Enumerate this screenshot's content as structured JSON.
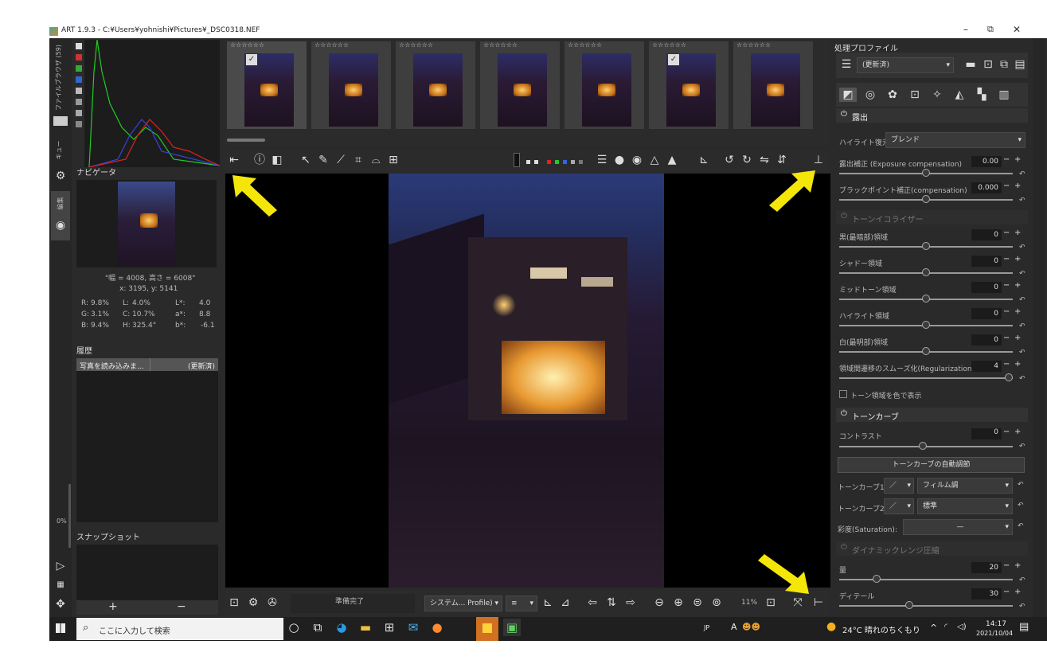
{
  "window": {
    "title": "ART 1.9.3 - C:¥Users¥yohnishi¥Pictures¥_DSC0318.NEF",
    "controls": {
      "minimize": "–",
      "restore": "⧉",
      "close": "✕"
    }
  },
  "left_tabs": {
    "file_browser": "ファイルブラウザ (59)",
    "queue": "キュー",
    "edit": "編集"
  },
  "navigator": {
    "title": "ナビゲータ",
    "size_line": "\"幅 = 4008, 高さ = 6008\"",
    "coords": "x: 3195, y: 5141",
    "rows": [
      [
        "R:",
        "9.8%",
        "L:",
        "4.0%",
        "L*:",
        "4.0"
      ],
      [
        "G:",
        "3.1%",
        "C:",
        "10.7%",
        "a*:",
        "8.8"
      ],
      [
        "B:",
        "9.4%",
        "H:",
        "325.4°",
        "b*:",
        "-6.1"
      ]
    ]
  },
  "history": {
    "title": "履歴",
    "rows": [
      {
        "action": "写真を読み込みま...",
        "value": "(更新済)"
      }
    ]
  },
  "snapshots": {
    "title": "スナップショット",
    "add": "+",
    "remove": "−"
  },
  "left_zoom_pct": "0%",
  "filmstrip": {
    "stars": "☆☆☆☆☆☆",
    "count": 7
  },
  "status": {
    "text": "準備完了",
    "profile": "システム... Profile)",
    "zoom": "11%"
  },
  "right_panel": {
    "profile_title": "処理プロファイル",
    "profile_value": "(更新済)",
    "exposure": {
      "title": "露出",
      "highlight_label": "ハイライト復元:",
      "highlight_value": "ブレンド",
      "items": [
        {
          "label": "露出補正 (Exposure compensation)",
          "value": "0.00",
          "pos": 0.5
        },
        {
          "label": "ブラックポイント補正(compensation)",
          "value": "0.000",
          "pos": 0.5
        }
      ]
    },
    "tone_eq": {
      "title": "トーンイコライザー",
      "items": [
        {
          "label": "黒(最暗部)領域",
          "value": "0",
          "pos": 0.5
        },
        {
          "label": "シャドー領域",
          "value": "0",
          "pos": 0.5
        },
        {
          "label": "ミッドトーン領域",
          "value": "0",
          "pos": 0.5
        },
        {
          "label": "ハイライト領域",
          "value": "0",
          "pos": 0.5
        },
        {
          "label": "白(最明部)領域",
          "value": "0",
          "pos": 0.5
        },
        {
          "label": "領域間遷移のスムーズ化(Regularization)",
          "value": "4",
          "pos": 1.0
        }
      ],
      "show_colors": "トーン領域を色で表示"
    },
    "tone_curve": {
      "title": "トーンカーブ",
      "contrast_label": "コントラスト",
      "contrast_value": "0",
      "contrast_pos": 0.5,
      "auto_button": "トーンカーブの自動調節",
      "curve1_label": "トーンカーブ1:",
      "curve1_value": "フィルム調",
      "curve2_label": "トーンカーブ2:",
      "curve2_value": "標準",
      "saturation_label": "彩度(Saturation):",
      "saturation_value": "—"
    },
    "drc": {
      "title": "ダイナミックレンジ圧縮",
      "items": [
        {
          "label": "量",
          "value": "20",
          "pos": 0.2
        },
        {
          "label": "ディテール",
          "value": "30",
          "pos": 0.4
        }
      ]
    }
  },
  "taskbar": {
    "search_placeholder": "ここに入力して検索",
    "ime": "JP",
    "ime_mode": "A",
    "weather": "24°C 晴れのちくもり",
    "time": "14:17",
    "date": "2021/10/04"
  },
  "colors": {
    "accent_arrow": "#f5e60a",
    "panel": "#2a2a2a",
    "taskbar": "#1f1f1f"
  }
}
